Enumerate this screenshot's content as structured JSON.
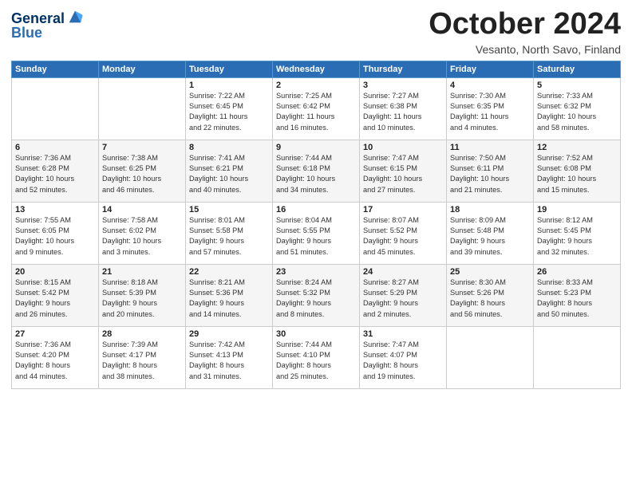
{
  "logo": {
    "line1": "General",
    "line2": "Blue"
  },
  "title": "October 2024",
  "location": "Vesanto, North Savo, Finland",
  "weekdays": [
    "Sunday",
    "Monday",
    "Tuesday",
    "Wednesday",
    "Thursday",
    "Friday",
    "Saturday"
  ],
  "weeks": [
    [
      {
        "day": "",
        "info": ""
      },
      {
        "day": "",
        "info": ""
      },
      {
        "day": "1",
        "info": "Sunrise: 7:22 AM\nSunset: 6:45 PM\nDaylight: 11 hours\nand 22 minutes."
      },
      {
        "day": "2",
        "info": "Sunrise: 7:25 AM\nSunset: 6:42 PM\nDaylight: 11 hours\nand 16 minutes."
      },
      {
        "day": "3",
        "info": "Sunrise: 7:27 AM\nSunset: 6:38 PM\nDaylight: 11 hours\nand 10 minutes."
      },
      {
        "day": "4",
        "info": "Sunrise: 7:30 AM\nSunset: 6:35 PM\nDaylight: 11 hours\nand 4 minutes."
      },
      {
        "day": "5",
        "info": "Sunrise: 7:33 AM\nSunset: 6:32 PM\nDaylight: 10 hours\nand 58 minutes."
      }
    ],
    [
      {
        "day": "6",
        "info": "Sunrise: 7:36 AM\nSunset: 6:28 PM\nDaylight: 10 hours\nand 52 minutes."
      },
      {
        "day": "7",
        "info": "Sunrise: 7:38 AM\nSunset: 6:25 PM\nDaylight: 10 hours\nand 46 minutes."
      },
      {
        "day": "8",
        "info": "Sunrise: 7:41 AM\nSunset: 6:21 PM\nDaylight: 10 hours\nand 40 minutes."
      },
      {
        "day": "9",
        "info": "Sunrise: 7:44 AM\nSunset: 6:18 PM\nDaylight: 10 hours\nand 34 minutes."
      },
      {
        "day": "10",
        "info": "Sunrise: 7:47 AM\nSunset: 6:15 PM\nDaylight: 10 hours\nand 27 minutes."
      },
      {
        "day": "11",
        "info": "Sunrise: 7:50 AM\nSunset: 6:11 PM\nDaylight: 10 hours\nand 21 minutes."
      },
      {
        "day": "12",
        "info": "Sunrise: 7:52 AM\nSunset: 6:08 PM\nDaylight: 10 hours\nand 15 minutes."
      }
    ],
    [
      {
        "day": "13",
        "info": "Sunrise: 7:55 AM\nSunset: 6:05 PM\nDaylight: 10 hours\nand 9 minutes."
      },
      {
        "day": "14",
        "info": "Sunrise: 7:58 AM\nSunset: 6:02 PM\nDaylight: 10 hours\nand 3 minutes."
      },
      {
        "day": "15",
        "info": "Sunrise: 8:01 AM\nSunset: 5:58 PM\nDaylight: 9 hours\nand 57 minutes."
      },
      {
        "day": "16",
        "info": "Sunrise: 8:04 AM\nSunset: 5:55 PM\nDaylight: 9 hours\nand 51 minutes."
      },
      {
        "day": "17",
        "info": "Sunrise: 8:07 AM\nSunset: 5:52 PM\nDaylight: 9 hours\nand 45 minutes."
      },
      {
        "day": "18",
        "info": "Sunrise: 8:09 AM\nSunset: 5:48 PM\nDaylight: 9 hours\nand 39 minutes."
      },
      {
        "day": "19",
        "info": "Sunrise: 8:12 AM\nSunset: 5:45 PM\nDaylight: 9 hours\nand 32 minutes."
      }
    ],
    [
      {
        "day": "20",
        "info": "Sunrise: 8:15 AM\nSunset: 5:42 PM\nDaylight: 9 hours\nand 26 minutes."
      },
      {
        "day": "21",
        "info": "Sunrise: 8:18 AM\nSunset: 5:39 PM\nDaylight: 9 hours\nand 20 minutes."
      },
      {
        "day": "22",
        "info": "Sunrise: 8:21 AM\nSunset: 5:36 PM\nDaylight: 9 hours\nand 14 minutes."
      },
      {
        "day": "23",
        "info": "Sunrise: 8:24 AM\nSunset: 5:32 PM\nDaylight: 9 hours\nand 8 minutes."
      },
      {
        "day": "24",
        "info": "Sunrise: 8:27 AM\nSunset: 5:29 PM\nDaylight: 9 hours\nand 2 minutes."
      },
      {
        "day": "25",
        "info": "Sunrise: 8:30 AM\nSunset: 5:26 PM\nDaylight: 8 hours\nand 56 minutes."
      },
      {
        "day": "26",
        "info": "Sunrise: 8:33 AM\nSunset: 5:23 PM\nDaylight: 8 hours\nand 50 minutes."
      }
    ],
    [
      {
        "day": "27",
        "info": "Sunrise: 7:36 AM\nSunset: 4:20 PM\nDaylight: 8 hours\nand 44 minutes."
      },
      {
        "day": "28",
        "info": "Sunrise: 7:39 AM\nSunset: 4:17 PM\nDaylight: 8 hours\nand 38 minutes."
      },
      {
        "day": "29",
        "info": "Sunrise: 7:42 AM\nSunset: 4:13 PM\nDaylight: 8 hours\nand 31 minutes."
      },
      {
        "day": "30",
        "info": "Sunrise: 7:44 AM\nSunset: 4:10 PM\nDaylight: 8 hours\nand 25 minutes."
      },
      {
        "day": "31",
        "info": "Sunrise: 7:47 AM\nSunset: 4:07 PM\nDaylight: 8 hours\nand 19 minutes."
      },
      {
        "day": "",
        "info": ""
      },
      {
        "day": "",
        "info": ""
      }
    ]
  ]
}
